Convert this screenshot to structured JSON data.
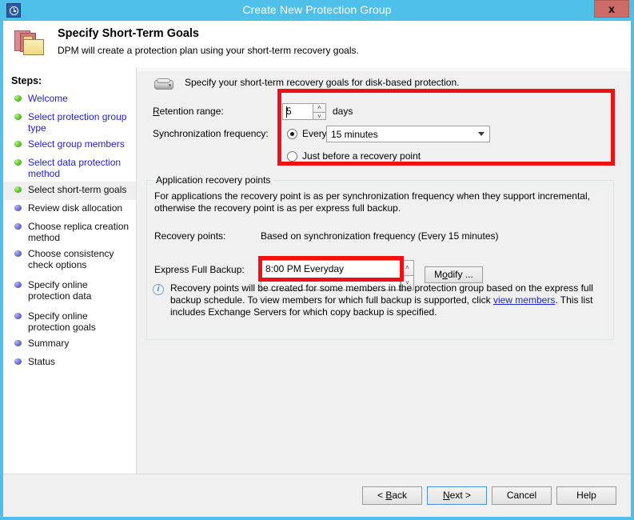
{
  "window": {
    "title": "Create New Protection Group",
    "app_icon": "recovery-clock-icon",
    "close_label": "x"
  },
  "header": {
    "title": "Specify Short-Term Goals",
    "subtitle": "DPM will create a protection plan using your short-term recovery goals.",
    "icon": "folder-stack-icon"
  },
  "sidebar": {
    "title": "Steps:",
    "items": [
      {
        "label": "Welcome",
        "state": "done"
      },
      {
        "label": "Select protection group type",
        "state": "done"
      },
      {
        "label": "Select group members",
        "state": "done"
      },
      {
        "label": "Select data protection method",
        "state": "done"
      },
      {
        "label": "Select short-term goals",
        "state": "current"
      },
      {
        "label": "Review disk allocation",
        "state": "todo"
      },
      {
        "label": "Choose replica creation method",
        "state": "todo"
      },
      {
        "label": "Choose consistency check options",
        "state": "todo"
      },
      {
        "label": "Specify online protection data",
        "state": "todo"
      },
      {
        "label": "Specify online protection goals",
        "state": "todo"
      },
      {
        "label": "Summary",
        "state": "todo"
      },
      {
        "label": "Status",
        "state": "todo"
      }
    ]
  },
  "main": {
    "intro_text": "Specify your short-term recovery goals for disk-based protection.",
    "intro_icon": "disk-drive-icon",
    "retention": {
      "label": "Retention range:",
      "value": "5",
      "unit": "days",
      "spin_up": "˄",
      "spin_down": "˅"
    },
    "sync": {
      "label": "Synchronization frequency:",
      "every_label": "Every",
      "every_selected": true,
      "interval_value": "15 minutes",
      "just_before_label": "Just before a recovery point",
      "just_before_selected": false
    },
    "group": {
      "title": "Application recovery points",
      "description": "For applications the recovery point is as per synchronization frequency when they support incremental, otherwise the recovery point is as per express full backup.",
      "recovery_points_label": "Recovery points:",
      "recovery_points_value": "Based on synchronization frequency (Every 15 minutes)",
      "express_label": "Express Full Backup:",
      "express_value": "8:00 PM Everyday",
      "modify_label": "Modify ...",
      "modify_mnemonic": "o",
      "note_prefix": "Recovery points will be created for some members in the protection group based on the express full backup schedule. To view members for which full backup is supported, click ",
      "note_link": "view members",
      "note_suffix": ". This list includes Exchange Servers for which copy backup is specified.",
      "info_icon": "info-icon",
      "info_glyph": "i"
    }
  },
  "footer": {
    "back_label": "< Back",
    "next_label": "Next >",
    "cancel_label": "Cancel",
    "help_label": "Help"
  },
  "annotations": {
    "highlight_color": "#ee1111",
    "boxes": [
      {
        "name": "retention-and-sync-highlight"
      },
      {
        "name": "express-full-backup-highlight"
      }
    ]
  }
}
